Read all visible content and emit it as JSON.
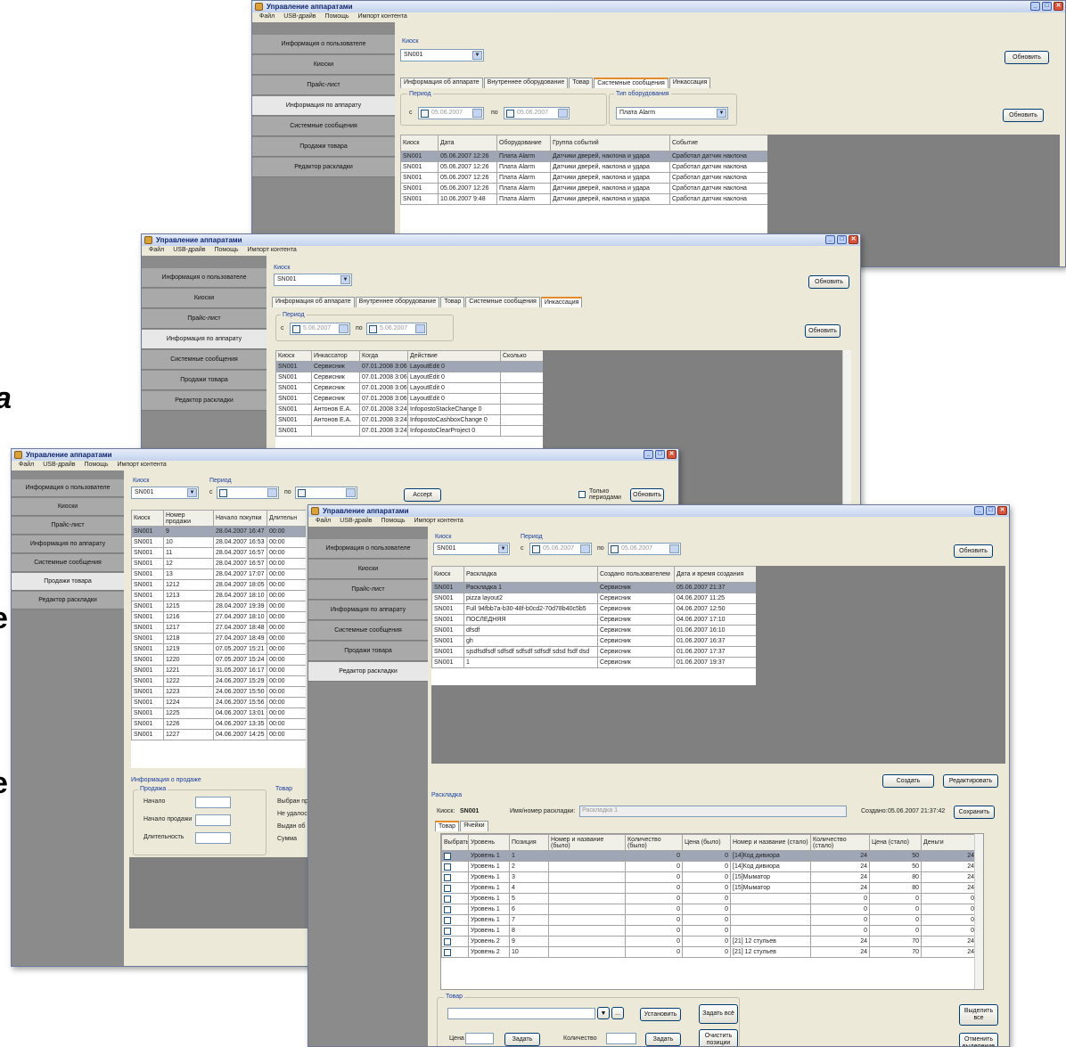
{
  "fragments": [
    "a",
    "e",
    "e"
  ],
  "menu": [
    "Файл",
    "USB-драйв",
    "Помощь",
    "Импорт контента"
  ],
  "nav": [
    "Информация о пользователе",
    "Киоски",
    "Прайс-лист",
    "Информация по аппарату",
    "Системные сообщения",
    "Продажи товара",
    "Редактор раскладки"
  ],
  "w1": {
    "title": "Управление аппаратами",
    "kiosk_label": "Киоск",
    "kiosk_value": "SN001",
    "refresh": "Обновить",
    "tabs": [
      "Информация об аппарате",
      "Внутреннее оборудование",
      "Товар",
      "Системные сообщения",
      "Инкассация"
    ],
    "period_label": "Период",
    "from": "с",
    "to": "по",
    "date_from": "05.06.2007",
    "date_to": "05.06.2007",
    "equip_type_label": "Тип оборудования",
    "equip_type_value": "Плата Alarm",
    "refresh2": "Обновить",
    "headers": [
      "Киоск",
      "Дата",
      "Оборудование",
      "Группа событий",
      "Событие"
    ],
    "rows": [
      [
        "SN001",
        "05.06.2007 12:26",
        "Плата Alarm",
        "Датчики дверей, наклона и удара",
        "Сработал датчик наклона"
      ],
      [
        "SN001",
        "05.06.2007 12:26",
        "Плата Alarm",
        "Датчики дверей, наклона и удара",
        "Сработал датчик наклона"
      ],
      [
        "SN001",
        "05.06.2007 12:26",
        "Плата Alarm",
        "Датчики дверей, наклона и удара",
        "Сработал датчик наклона"
      ],
      [
        "SN001",
        "05.06.2007 12:26",
        "Плата Alarm",
        "Датчики дверей, наклона и удара",
        "Сработал датчик наклона"
      ],
      [
        "SN001",
        "10.06.2007 9:48",
        "Плата Alarm",
        "Датчики дверей, наклона и удара",
        "Сработал датчик наклона"
      ]
    ]
  },
  "w2": {
    "title": "Управление аппаратами",
    "kiosk_label": "Киоск",
    "kiosk_value": "SN001",
    "refresh": "Обновить",
    "tabs": [
      "Информация об аппарате",
      "Внутреннее оборудование",
      "Товар",
      "Системные сообщения",
      "Инкассация"
    ],
    "period_label": "Период",
    "from": "с",
    "to": "по",
    "date_from": "5.06.2007",
    "date_to": "5.06.2007",
    "refresh2": "Обновить",
    "headers": [
      "Киоск",
      "Инкассатор",
      "Когда",
      "Действие",
      "Сколько"
    ],
    "rows": [
      [
        "SN001",
        "Сервисник",
        "07.01.2008 3:06",
        "LayoutEdit 0",
        ""
      ],
      [
        "SN001",
        "Сервисник",
        "07.01.2008 3:06",
        "LayoutEdit 0",
        ""
      ],
      [
        "SN001",
        "Сервисник",
        "07.01.2008 3:06",
        "LayoutEdit 0",
        ""
      ],
      [
        "SN001",
        "Сервисник",
        "07.01.2008 3:06",
        "LayoutEdit 0",
        ""
      ],
      [
        "SN001",
        "Антонов Е.А.",
        "07.01.2008 3:24",
        "InfopostoStackeChange 0",
        ""
      ],
      [
        "SN001",
        "Антонов Е.А.",
        "07.01.2008 3:24",
        "InfopostoCashboxChange 0",
        ""
      ],
      [
        "SN001",
        "",
        "07.01.2008 3:24",
        "InfopostoClearProject 0",
        ""
      ]
    ]
  },
  "w3": {
    "title": "Управление аппаратами",
    "kiosk_label": "Киоск",
    "kiosk_value": "SN001",
    "period_label": "Период",
    "from": "с",
    "to": "по",
    "apply": "Accept",
    "only_dates": "Только периодами",
    "refresh": "Обновить",
    "headers": [
      "Киоск",
      "Номер продажи",
      "Начало покупки",
      "Длительн"
    ],
    "rows": [
      [
        "SN001",
        "9",
        "28.04.2007 16:47",
        "00:00"
      ],
      [
        "SN001",
        "10",
        "28.04.2007 16:53",
        "00:00"
      ],
      [
        "SN001",
        "11",
        "28.04.2007 16:57",
        "00:00"
      ],
      [
        "SN001",
        "12",
        "28.04.2007 16:57",
        "00:00"
      ],
      [
        "SN001",
        "13",
        "28.04.2007 17:07",
        "00:00"
      ],
      [
        "SN001",
        "1212",
        "28.04.2007 18:05",
        "00:00"
      ],
      [
        "SN001",
        "1213",
        "28.04.2007 18:10",
        "00:00"
      ],
      [
        "SN001",
        "1215",
        "28.04.2007 19:39",
        "00:00"
      ],
      [
        "SN001",
        "1216",
        "27.04.2007 18:10",
        "00:00"
      ],
      [
        "SN001",
        "1217",
        "27.04.2007 18:48",
        "00:00"
      ],
      [
        "SN001",
        "1218",
        "27.04.2007 18:49",
        "00:00"
      ],
      [
        "SN001",
        "1219",
        "07.05.2007 15:21",
        "00:00"
      ],
      [
        "SN001",
        "1220",
        "07.05.2007 15:24",
        "00:00"
      ],
      [
        "SN001",
        "1221",
        "31.05.2007 16:17",
        "00:00"
      ],
      [
        "SN001",
        "1222",
        "24.06.2007 15:29",
        "00:00"
      ],
      [
        "SN001",
        "1223",
        "24.06.2007 15:50",
        "00:00"
      ],
      [
        "SN001",
        "1224",
        "24.06.2007 15:56",
        "00:00"
      ],
      [
        "SN001",
        "1225",
        "04.06.2007 13:01",
        "00:00"
      ],
      [
        "SN001",
        "1226",
        "04.06.2007 13:35",
        "00:00"
      ],
      [
        "SN001",
        "1227",
        "04.06.2007 14:25",
        "00:00"
      ]
    ],
    "info_title": "Информация о продаже",
    "sale_label": "Продажа",
    "start_label": "Начало",
    "end_label": "Начало продажи",
    "duration_label": "Длительность",
    "goods_label": "Товар",
    "goods_items": [
      "Выбран про",
      "Не удалось",
      "Выдан об",
      "Сумма"
    ]
  },
  "w4": {
    "title": "Управление аппаратами",
    "kiosk_label": "Киоск",
    "kiosk_value": "SN001",
    "period_label": "Период",
    "from": "с",
    "to": "по",
    "date_from": "05.06.2007",
    "date_to": "05.06.2007",
    "refresh": "Обновить",
    "headers": [
      "Киоск",
      "Раскладка",
      "Создано пользователем",
      "Дата и время создания"
    ],
    "rows": [
      [
        "SN001",
        "Раскладка 1",
        "Сервисник",
        "05.06.2007 21:37"
      ],
      [
        "SN001",
        "pizza layout2",
        "Сервисник",
        "04.06.2007 11:25"
      ],
      [
        "SN001",
        "Full 94fbb7a-b30-48f-b0cd2-70d78b40c5b5",
        "Сервисник",
        "04.06.2007 12:50"
      ],
      [
        "SN001",
        "ПОСЛЕДНЯЯ",
        "Сервисник",
        "04.06.2007 17:10"
      ],
      [
        "SN001",
        "dfsdf",
        "Сервисник",
        "01.06.2007 16:10"
      ],
      [
        "SN001",
        "gh",
        "Сервисник",
        "01.06.2007 16:37"
      ],
      [
        "SN001",
        "sjsdfsdfsdf sdfsdf sdfsdf sdfsdf sdsd fsdf dsd",
        "Сервисник",
        "01.06.2007 17:37"
      ],
      [
        "SN001",
        "1",
        "Сервисник",
        "01.06.2007 19:37"
      ]
    ],
    "create": "Создать",
    "edit": "Редактировать",
    "layout_label": "Раскладка",
    "kiosk_lbl2": "Киоск:",
    "kiosk_val2": "SN001",
    "layout_name_label": "Имя/номер раскладки:",
    "layout_name_value": "Раскладка 1",
    "created_label": "Создано:",
    "created_value": "05.06.2007 21:37:42",
    "save": "Сохранить",
    "subtabs": [
      "Товар",
      "Ячейки"
    ],
    "grid_headers": [
      "Выбрать",
      "Уровень",
      "Позиция",
      "Номер и название (было)",
      "Количество (было)",
      "Цена (было)",
      "Номер и название (стало)",
      "Количество (стало)",
      "Цена (стало)",
      "Деньги"
    ],
    "grid_rows": [
      [
        "Уровень 1",
        "1",
        "",
        "0",
        "0",
        "[14]Код дивиора",
        "24",
        "50",
        "24"
      ],
      [
        "Уровень 1",
        "2",
        "",
        "0",
        "0",
        "[14]Код дивиора",
        "24",
        "50",
        "24"
      ],
      [
        "Уровень 1",
        "3",
        "",
        "0",
        "0",
        "[15]Мыматор",
        "24",
        "80",
        "24"
      ],
      [
        "Уровень 1",
        "4",
        "",
        "0",
        "0",
        "[15]Мыматор",
        "24",
        "80",
        "24"
      ],
      [
        "Уровень 1",
        "5",
        "",
        "0",
        "0",
        "",
        "0",
        "0",
        "0"
      ],
      [
        "Уровень 1",
        "6",
        "",
        "0",
        "0",
        "",
        "0",
        "0",
        "0"
      ],
      [
        "Уровень 1",
        "7",
        "",
        "0",
        "0",
        "",
        "0",
        "0",
        "0"
      ],
      [
        "Уровень 1",
        "8",
        "",
        "0",
        "0",
        "",
        "0",
        "0",
        "0"
      ],
      [
        "Уровень 2",
        "9",
        "",
        "0",
        "0",
        "[21] 12 стульев",
        "24",
        "70",
        "24"
      ],
      [
        "Уровень 2",
        "10",
        "",
        "0",
        "0",
        "[21] 12 стульев",
        "24",
        "70",
        "24"
      ]
    ],
    "goods_label": "Товар",
    "ellipsis": "...",
    "install": "Установить",
    "set_all": "Задать всё",
    "price_label": "Цена",
    "set_price": "Задать",
    "qty_label": "Количество",
    "set_qty": "Задать",
    "empty_pos": "Очистить позиции",
    "select_all": "Выделить все",
    "deselect": "Отменить выделение"
  }
}
